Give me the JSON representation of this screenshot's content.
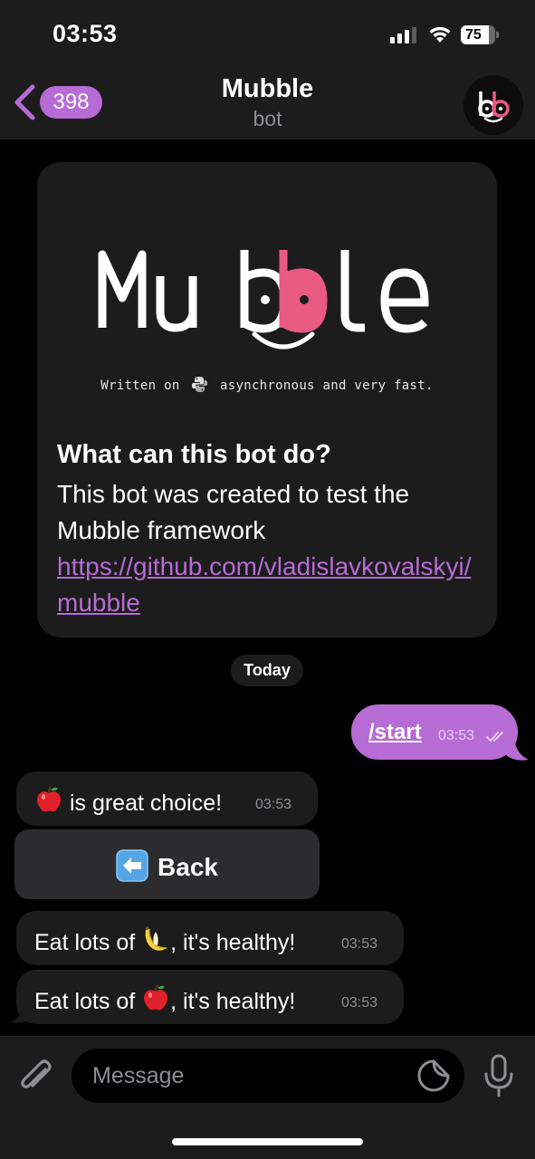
{
  "status_bar": {
    "time": "03:53",
    "battery": "75"
  },
  "nav": {
    "back_count": "398",
    "title": "Mubble",
    "subtitle": "bot",
    "avatar_icon": "mubble-logo-avatar"
  },
  "info_card": {
    "logo_text": "Mubble",
    "tagline_before": "Written on",
    "tagline_after": "asynchronous and very fast.",
    "heading": "What can this bot do?",
    "description": "This bot was created to test the Mubble framework",
    "link": "https://github.com/vladislavkovalskyi/mubble"
  },
  "date_chip": "Today",
  "messages": {
    "out_1": {
      "text": "/start",
      "time": "03:53",
      "status_icon": "double-check-icon"
    },
    "in_1": {
      "text": " is great choice!",
      "emoji": "apple",
      "time": "03:53"
    },
    "in_2": {
      "text_before": "Eat lots of ",
      "emoji": "banana",
      "text_after": ", it's healthy!",
      "time": "03:53"
    },
    "in_3": {
      "text_before": "Eat lots of ",
      "emoji": "apple",
      "text_after": ", it's healthy!",
      "time": "03:53"
    }
  },
  "keyboard": {
    "back_label": "Back",
    "back_icon": "left-arrow-emoji"
  },
  "input": {
    "placeholder": "Message"
  },
  "colors": {
    "accent": "#b76bd4",
    "bubble": "#1c1c1d",
    "bar": "#1c1c1d",
    "logo_pink": "#e85a82"
  }
}
